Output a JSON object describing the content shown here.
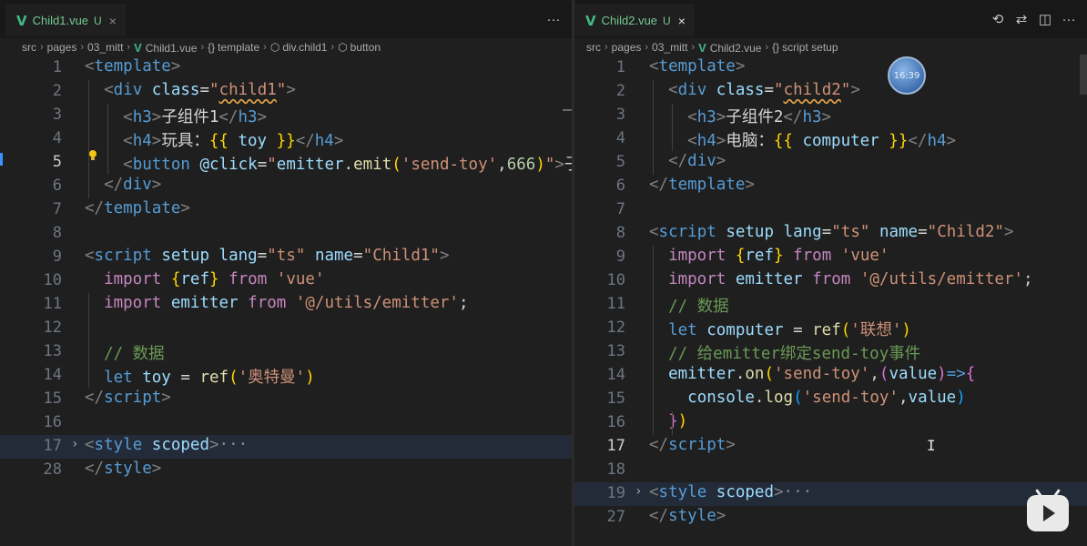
{
  "left": {
    "tab": {
      "icon": "V",
      "title": "Child1.vue",
      "badge": "U",
      "close": "×"
    },
    "more": "···",
    "breadcrumb": [
      "src",
      "pages",
      "03_mitt",
      "Child1.vue",
      "template",
      "div.child1",
      "button"
    ],
    "lines": [
      {
        "n": "1",
        "tokens": [
          [
            "t-br",
            "<"
          ],
          [
            "t-tag",
            "template"
          ],
          [
            "t-br",
            ">"
          ]
        ]
      },
      {
        "n": "2",
        "tokens": [
          [
            "t-plain",
            "  "
          ],
          [
            "t-br",
            "<"
          ],
          [
            "t-tag",
            "div"
          ],
          [
            "t-plain",
            " "
          ],
          [
            "t-attr",
            "class"
          ],
          [
            "t-plain",
            "="
          ],
          [
            "t-str",
            "\""
          ],
          [
            "t-str t-sq",
            "child1"
          ],
          [
            "t-str",
            "\""
          ],
          [
            "t-br",
            ">"
          ]
        ]
      },
      {
        "n": "3",
        "tokens": [
          [
            "t-plain",
            "    "
          ],
          [
            "t-br",
            "<"
          ],
          [
            "t-tag",
            "h3"
          ],
          [
            "t-br",
            ">"
          ],
          [
            "t-plain",
            "子组件1"
          ],
          [
            "t-br",
            "</"
          ],
          [
            "t-tag",
            "h3"
          ],
          [
            "t-br",
            ">"
          ]
        ]
      },
      {
        "n": "4",
        "tokens": [
          [
            "t-plain",
            "    "
          ],
          [
            "t-br",
            "<"
          ],
          [
            "t-tag",
            "h4"
          ],
          [
            "t-br",
            ">"
          ],
          [
            "t-plain",
            "玩具："
          ],
          [
            "t-p1",
            "{{"
          ],
          [
            "t-plain",
            " "
          ],
          [
            "t-var",
            "toy"
          ],
          [
            "t-plain",
            " "
          ],
          [
            "t-p1",
            "}}"
          ],
          [
            "t-br",
            "</"
          ],
          [
            "t-tag",
            "h4"
          ],
          [
            "t-br",
            ">"
          ]
        ]
      },
      {
        "n": "5",
        "tokens": [
          [
            "t-plain",
            "    "
          ],
          [
            "t-br",
            "<"
          ],
          [
            "t-tag",
            "button"
          ],
          [
            "t-plain",
            " "
          ],
          [
            "t-attr",
            "@click"
          ],
          [
            "t-plain",
            "="
          ],
          [
            "t-str",
            "\""
          ],
          [
            "t-var",
            "emitter"
          ],
          [
            "t-plain",
            "."
          ],
          [
            "t-fn",
            "emit"
          ],
          [
            "t-p1",
            "("
          ],
          [
            "t-str",
            "'send-toy'"
          ],
          [
            "t-plain",
            ","
          ],
          [
            "t-num",
            "666"
          ],
          [
            "t-p1",
            ")"
          ],
          [
            "t-str",
            "\""
          ],
          [
            "t-br",
            ">"
          ],
          [
            "t-plain",
            "子"
          ]
        ],
        "active": true
      },
      {
        "n": "6",
        "tokens": [
          [
            "t-plain",
            "  "
          ],
          [
            "t-br",
            "</"
          ],
          [
            "t-tag",
            "div"
          ],
          [
            "t-br",
            ">"
          ]
        ]
      },
      {
        "n": "7",
        "tokens": [
          [
            "t-br",
            "</"
          ],
          [
            "t-tag",
            "template"
          ],
          [
            "t-br",
            ">"
          ]
        ]
      },
      {
        "n": "8",
        "tokens": []
      },
      {
        "n": "9",
        "tokens": [
          [
            "t-br",
            "<"
          ],
          [
            "t-tag",
            "script"
          ],
          [
            "t-plain",
            " "
          ],
          [
            "t-attr",
            "setup"
          ],
          [
            "t-plain",
            " "
          ],
          [
            "t-attr",
            "lang"
          ],
          [
            "t-plain",
            "="
          ],
          [
            "t-str",
            "\"ts\""
          ],
          [
            "t-plain",
            " "
          ],
          [
            "t-attr",
            "name"
          ],
          [
            "t-plain",
            "="
          ],
          [
            "t-str",
            "\"Child1\""
          ],
          [
            "t-br",
            ">"
          ]
        ]
      },
      {
        "n": "10",
        "tokens": [
          [
            "t-plain",
            "  "
          ],
          [
            "t-kw",
            "import"
          ],
          [
            "t-plain",
            " "
          ],
          [
            "t-p1",
            "{"
          ],
          [
            "t-var",
            "ref"
          ],
          [
            "t-p1",
            "}"
          ],
          [
            "t-plain",
            " "
          ],
          [
            "t-kw",
            "from"
          ],
          [
            "t-plain",
            " "
          ],
          [
            "t-str",
            "'vue'"
          ]
        ]
      },
      {
        "n": "11",
        "tokens": [
          [
            "t-plain",
            "  "
          ],
          [
            "t-kw",
            "import"
          ],
          [
            "t-plain",
            " "
          ],
          [
            "t-var",
            "emitter"
          ],
          [
            "t-plain",
            " "
          ],
          [
            "t-kw",
            "from"
          ],
          [
            "t-plain",
            " "
          ],
          [
            "t-str",
            "'@/utils/emitter'"
          ],
          [
            "t-plain",
            ";"
          ]
        ]
      },
      {
        "n": "12",
        "tokens": []
      },
      {
        "n": "13",
        "tokens": [
          [
            "t-plain",
            "  "
          ],
          [
            "t-cmt",
            "// 数据"
          ]
        ]
      },
      {
        "n": "14",
        "tokens": [
          [
            "t-plain",
            "  "
          ],
          [
            "t-kw2",
            "let"
          ],
          [
            "t-plain",
            " "
          ],
          [
            "t-var",
            "toy"
          ],
          [
            "t-plain",
            " = "
          ],
          [
            "t-fn",
            "ref"
          ],
          [
            "t-p1",
            "("
          ],
          [
            "t-str",
            "'奥特曼'"
          ],
          [
            "t-p1",
            ")"
          ]
        ]
      },
      {
        "n": "15",
        "tokens": [
          [
            "t-br",
            "</"
          ],
          [
            "t-tag",
            "script"
          ],
          [
            "t-br",
            ">"
          ]
        ]
      },
      {
        "n": "16",
        "tokens": []
      },
      {
        "n": "17",
        "tokens": [
          [
            "t-br",
            "<"
          ],
          [
            "t-tag",
            "style"
          ],
          [
            "t-plain",
            " "
          ],
          [
            "t-attr",
            "scoped"
          ],
          [
            "t-br",
            ">"
          ],
          [
            "fold-dots",
            "···"
          ]
        ],
        "fold": "›",
        "hl": true
      },
      {
        "n": "28",
        "tokens": [
          [
            "t-br",
            "</"
          ],
          [
            "t-tag",
            "style"
          ],
          [
            "t-br",
            ">"
          ]
        ]
      }
    ]
  },
  "right": {
    "tab": {
      "icon": "V",
      "title": "Child2.vue",
      "badge": "U",
      "close": "×"
    },
    "actions": [
      "history-icon",
      "compare-icon",
      "split-icon",
      "more-icon"
    ],
    "action_glyphs": [
      "⟲",
      "⇄",
      "◫",
      "···"
    ],
    "breadcrumb": [
      "src",
      "pages",
      "03_mitt",
      "Child2.vue",
      "script setup"
    ],
    "lines": [
      {
        "n": "1",
        "tokens": [
          [
            "t-br",
            "<"
          ],
          [
            "t-tag",
            "template"
          ],
          [
            "t-br",
            ">"
          ]
        ]
      },
      {
        "n": "2",
        "tokens": [
          [
            "t-plain",
            "  "
          ],
          [
            "t-br",
            "<"
          ],
          [
            "t-tag",
            "div"
          ],
          [
            "t-plain",
            " "
          ],
          [
            "t-attr",
            "class"
          ],
          [
            "t-plain",
            "="
          ],
          [
            "t-str",
            "\""
          ],
          [
            "t-str t-sq",
            "child2"
          ],
          [
            "t-str",
            "\""
          ],
          [
            "t-br",
            ">"
          ]
        ]
      },
      {
        "n": "3",
        "tokens": [
          [
            "t-plain",
            "    "
          ],
          [
            "t-br",
            "<"
          ],
          [
            "t-tag",
            "h3"
          ],
          [
            "t-br",
            ">"
          ],
          [
            "t-plain",
            "子组件2"
          ],
          [
            "t-br",
            "</"
          ],
          [
            "t-tag",
            "h3"
          ],
          [
            "t-br",
            ">"
          ]
        ]
      },
      {
        "n": "4",
        "tokens": [
          [
            "t-plain",
            "    "
          ],
          [
            "t-br",
            "<"
          ],
          [
            "t-tag",
            "h4"
          ],
          [
            "t-br",
            ">"
          ],
          [
            "t-plain",
            "电脑："
          ],
          [
            "t-p1",
            "{{"
          ],
          [
            "t-plain",
            " "
          ],
          [
            "t-var",
            "computer"
          ],
          [
            "t-plain",
            " "
          ],
          [
            "t-p1",
            "}}"
          ],
          [
            "t-br",
            "</"
          ],
          [
            "t-tag",
            "h4"
          ],
          [
            "t-br",
            ">"
          ]
        ]
      },
      {
        "n": "5",
        "tokens": [
          [
            "t-plain",
            "  "
          ],
          [
            "t-br",
            "</"
          ],
          [
            "t-tag",
            "div"
          ],
          [
            "t-br",
            ">"
          ]
        ]
      },
      {
        "n": "6",
        "tokens": [
          [
            "t-br",
            "</"
          ],
          [
            "t-tag",
            "template"
          ],
          [
            "t-br",
            ">"
          ]
        ]
      },
      {
        "n": "7",
        "tokens": []
      },
      {
        "n": "8",
        "tokens": [
          [
            "t-br",
            "<"
          ],
          [
            "t-tag",
            "script"
          ],
          [
            "t-plain",
            " "
          ],
          [
            "t-attr",
            "setup"
          ],
          [
            "t-plain",
            " "
          ],
          [
            "t-attr",
            "lang"
          ],
          [
            "t-plain",
            "="
          ],
          [
            "t-str",
            "\"ts\""
          ],
          [
            "t-plain",
            " "
          ],
          [
            "t-attr",
            "name"
          ],
          [
            "t-plain",
            "="
          ],
          [
            "t-str",
            "\"Child2\""
          ],
          [
            "t-br",
            ">"
          ]
        ]
      },
      {
        "n": "9",
        "tokens": [
          [
            "t-plain",
            "  "
          ],
          [
            "t-kw",
            "import"
          ],
          [
            "t-plain",
            " "
          ],
          [
            "t-p1",
            "{"
          ],
          [
            "t-var",
            "ref"
          ],
          [
            "t-p1",
            "}"
          ],
          [
            "t-plain",
            " "
          ],
          [
            "t-kw",
            "from"
          ],
          [
            "t-plain",
            " "
          ],
          [
            "t-str",
            "'vue'"
          ]
        ]
      },
      {
        "n": "10",
        "tokens": [
          [
            "t-plain",
            "  "
          ],
          [
            "t-kw",
            "import"
          ],
          [
            "t-plain",
            " "
          ],
          [
            "t-var",
            "emitter"
          ],
          [
            "t-plain",
            " "
          ],
          [
            "t-kw",
            "from"
          ],
          [
            "t-plain",
            " "
          ],
          [
            "t-str",
            "'@/utils/emitter'"
          ],
          [
            "t-plain",
            ";"
          ]
        ]
      },
      {
        "n": "11",
        "tokens": [
          [
            "t-plain",
            "  "
          ],
          [
            "t-cmt",
            "// 数据"
          ]
        ]
      },
      {
        "n": "12",
        "tokens": [
          [
            "t-plain",
            "  "
          ],
          [
            "t-kw2",
            "let"
          ],
          [
            "t-plain",
            " "
          ],
          [
            "t-var",
            "computer"
          ],
          [
            "t-plain",
            " = "
          ],
          [
            "t-fn",
            "ref"
          ],
          [
            "t-p1",
            "("
          ],
          [
            "t-str",
            "'联想'"
          ],
          [
            "t-p1",
            ")"
          ]
        ]
      },
      {
        "n": "13",
        "tokens": [
          [
            "t-plain",
            "  "
          ],
          [
            "t-cmt",
            "// 给emitter绑定send-toy事件"
          ]
        ]
      },
      {
        "n": "14",
        "tokens": [
          [
            "t-plain",
            "  "
          ],
          [
            "t-var",
            "emitter"
          ],
          [
            "t-plain",
            "."
          ],
          [
            "t-fn",
            "on"
          ],
          [
            "t-p1",
            "("
          ],
          [
            "t-str",
            "'send-toy'"
          ],
          [
            "t-plain",
            ","
          ],
          [
            "t-p2",
            "("
          ],
          [
            "t-var",
            "value"
          ],
          [
            "t-p2",
            ")"
          ],
          [
            "t-kw2",
            "=>"
          ],
          [
            "t-p2",
            "{"
          ]
        ]
      },
      {
        "n": "15",
        "tokens": [
          [
            "t-plain",
            "    "
          ],
          [
            "t-var",
            "console"
          ],
          [
            "t-plain",
            "."
          ],
          [
            "t-fn",
            "log"
          ],
          [
            "t-p3",
            "("
          ],
          [
            "t-str",
            "'send-toy'"
          ],
          [
            "t-plain",
            ","
          ],
          [
            "t-var",
            "value"
          ],
          [
            "t-p3",
            ")"
          ]
        ]
      },
      {
        "n": "16",
        "tokens": [
          [
            "t-plain",
            "  "
          ],
          [
            "t-p2",
            "}"
          ],
          [
            "t-p1",
            ")"
          ]
        ]
      },
      {
        "n": "17",
        "tokens": [
          [
            "t-br",
            "</"
          ],
          [
            "t-tag",
            "script"
          ],
          [
            "t-br",
            ">"
          ]
        ],
        "active": true
      },
      {
        "n": "18",
        "tokens": []
      },
      {
        "n": "19",
        "tokens": [
          [
            "t-br",
            "<"
          ],
          [
            "t-tag",
            "style"
          ],
          [
            "t-plain",
            " "
          ],
          [
            "t-attr",
            "scoped"
          ],
          [
            "t-br",
            ">"
          ],
          [
            "fold-dots",
            "···"
          ]
        ],
        "fold": "›",
        "hl": true
      },
      {
        "n": "27",
        "tokens": [
          [
            "t-br",
            "</"
          ],
          [
            "t-tag",
            "style"
          ],
          [
            "t-br",
            ">"
          ]
        ]
      }
    ]
  },
  "overlay": {
    "clock_text": "16:39",
    "cursor": "I"
  }
}
